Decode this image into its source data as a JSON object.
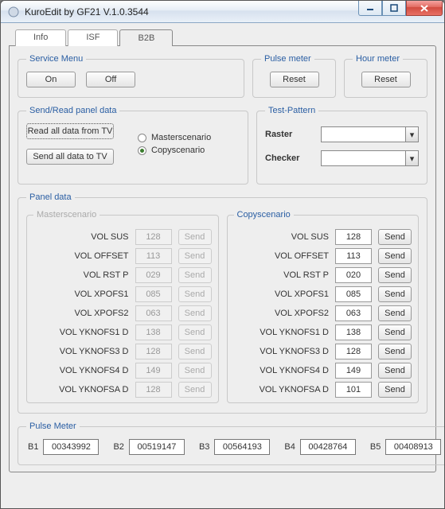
{
  "title": "KuroEdit by GF21 V.1.0.3544",
  "tabs": {
    "info": "Info",
    "isf": "ISF",
    "b2b": "B2B"
  },
  "serviceMenu": {
    "legend": "Service Menu",
    "on": "On",
    "off": "Off"
  },
  "pulseMeterBox": {
    "legend": "Pulse meter",
    "reset": "Reset"
  },
  "hourMeterBox": {
    "legend": "Hour meter",
    "reset": "Reset"
  },
  "sendRead": {
    "legend": "Send/Read panel data",
    "readAll": "Read all data from TV",
    "sendAll": "Send all data to TV",
    "master": "Masterscenario",
    "copy": "Copyscenario",
    "selected": "copy"
  },
  "testPattern": {
    "legend": "Test-Pattern",
    "rasterLabel": "Raster",
    "checkerLabel": "Checker",
    "rasterValue": "",
    "checkerValue": ""
  },
  "panelData": {
    "legend": "Panel data",
    "masterLegend": "Masterscenario",
    "copyLegend": "Copyscenario",
    "sendLabel": "Send",
    "master": [
      {
        "label": "VOL SUS",
        "value": "128"
      },
      {
        "label": "VOL OFFSET",
        "value": "113"
      },
      {
        "label": "VOL RST P",
        "value": "029"
      },
      {
        "label": "VOL XPOFS1",
        "value": "085"
      },
      {
        "label": "VOL XPOFS2",
        "value": "063"
      },
      {
        "label": "VOL YKNOFS1 D",
        "value": "138"
      },
      {
        "label": "VOL YKNOFS3 D",
        "value": "128"
      },
      {
        "label": "VOL YKNOFS4 D",
        "value": "149"
      },
      {
        "label": "VOL YKNOFSA D",
        "value": "128"
      }
    ],
    "copy": [
      {
        "label": "VOL SUS",
        "value": "128"
      },
      {
        "label": "VOL OFFSET",
        "value": "113"
      },
      {
        "label": "VOL RST P",
        "value": "020"
      },
      {
        "label": "VOL XPOFS1",
        "value": "085"
      },
      {
        "label": "VOL XPOFS2",
        "value": "063"
      },
      {
        "label": "VOL YKNOFS1 D",
        "value": "138"
      },
      {
        "label": "VOL YKNOFS3 D",
        "value": "128"
      },
      {
        "label": "VOL YKNOFS4 D",
        "value": "149"
      },
      {
        "label": "VOL YKNOFSA D",
        "value": "101"
      }
    ]
  },
  "pulseMeter": {
    "legend": "Pulse Meter",
    "items": [
      {
        "label": "B1",
        "value": "00343992"
      },
      {
        "label": "B2",
        "value": "00519147"
      },
      {
        "label": "B3",
        "value": "00564193"
      },
      {
        "label": "B4",
        "value": "00428764"
      },
      {
        "label": "B5",
        "value": "00408913"
      }
    ]
  }
}
